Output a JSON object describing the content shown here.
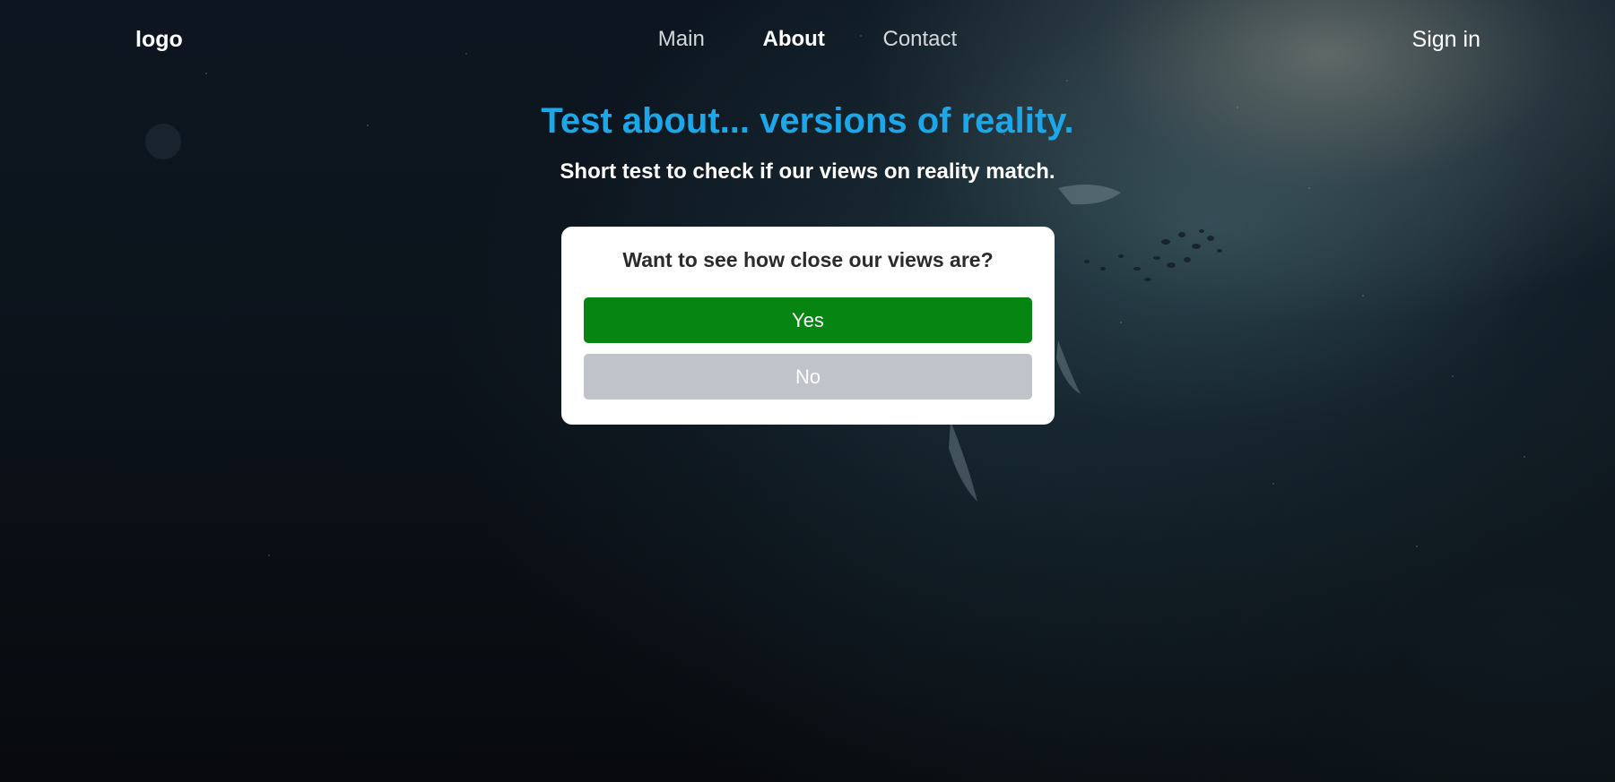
{
  "nav": {
    "logo": "logo",
    "links": [
      {
        "label": "Main",
        "active": false
      },
      {
        "label": "About",
        "active": true
      },
      {
        "label": "Contact",
        "active": false
      }
    ],
    "sign_in": "Sign in"
  },
  "hero": {
    "title": "Test about... versions of reality.",
    "subtitle": "Short test to check if our views on reality match."
  },
  "card": {
    "question": "Want to see how close our views are?",
    "yes_label": "Yes",
    "no_label": "No"
  },
  "colors": {
    "title_accent": "#1ba8ea",
    "yes_button": "#078512",
    "no_button": "#c0c4ca",
    "card_background": "#ffffff"
  }
}
